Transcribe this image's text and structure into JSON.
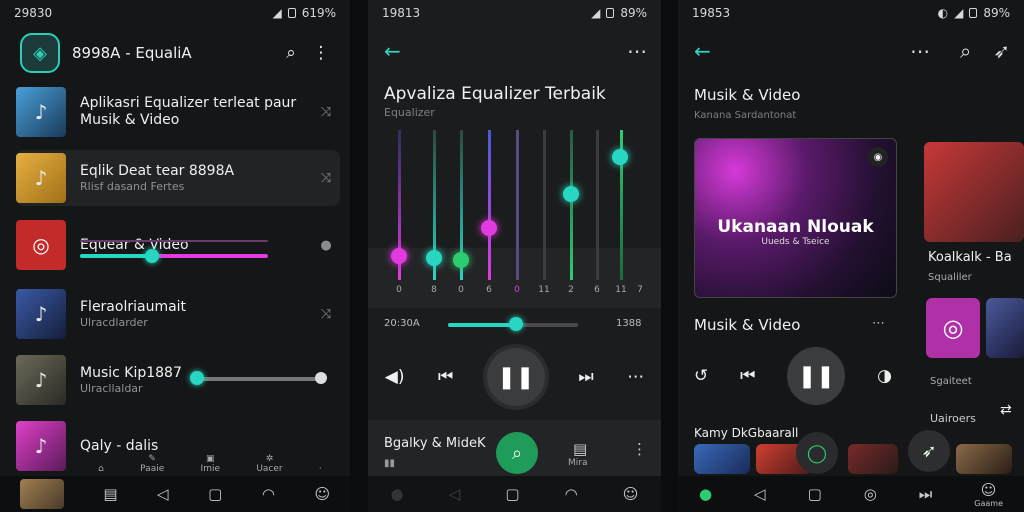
{
  "screen1": {
    "status_time": "29830",
    "status_battery": "619%",
    "app_title": "8998A - EqualiA",
    "items": [
      {
        "title": "Aplikasri Equalizer terleat paur",
        "title2": "Musik & Video",
        "sub": ""
      },
      {
        "title": "Eqlik Deat tear 8898A",
        "sub": "Rlisf dasand Fertes"
      },
      {
        "title": "Equear & Video",
        "title_accent": "Video",
        "sub": ""
      },
      {
        "title": "Fleraolriaumait",
        "sub": "Ulracdlarder"
      },
      {
        "title": "Music Kip1887",
        "sub": "Ulracllaldar"
      },
      {
        "title": "Qaly - dalis",
        "sub": ""
      }
    ],
    "nav_labels": [
      "Paaie",
      "Imie",
      "Uacer"
    ]
  },
  "screen2": {
    "status_time": "19813",
    "status_battery": "89%",
    "title": "Apvaliza Equalizer Terbaik",
    "subtitle": "Equalizer",
    "eq_labels": [
      "0",
      "8",
      "0",
      "6",
      "0",
      "11",
      "2",
      "6",
      "11",
      "7"
    ],
    "time_left": "20:30A",
    "time_right": "1388",
    "bottom_title": "Bgalky & MideK",
    "bottom_sub": "Mira"
  },
  "screen3": {
    "status_time": "19853",
    "status_battery": "89%",
    "section1_title": "Musik & Video",
    "section1_sub": "Kanana Sardantonat",
    "hero_title": "Ukanaan Nlouak",
    "hero_sub": "Uueds & Tseice",
    "side_title": "Koalkalk - Ba",
    "side_sub": "Squaliler",
    "section2_title": "Musik & Video",
    "side_labels": [
      "Sgaiteet",
      "Uairoers"
    ],
    "bottom_title": "Kamy DkGbaarall",
    "nav_label": "Gaame"
  },
  "colors": {
    "accent": "#27d7c2",
    "magenta": "#e13ae0",
    "green": "#2ecc71"
  }
}
